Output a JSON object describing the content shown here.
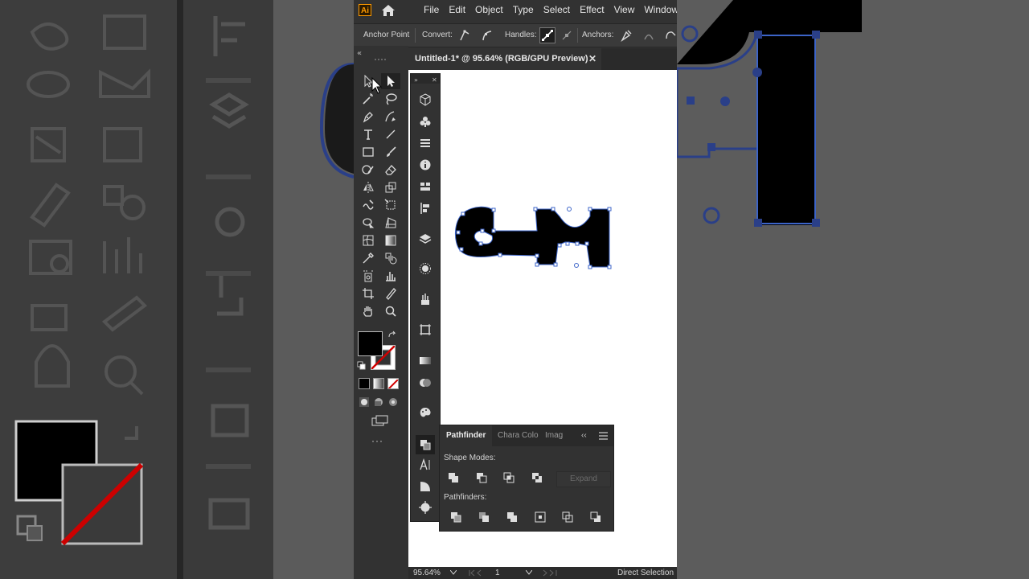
{
  "app": {
    "logo": "Ai"
  },
  "menu": [
    "File",
    "Edit",
    "Object",
    "Type",
    "Select",
    "Effect",
    "View",
    "Window"
  ],
  "control_bar": {
    "title": "Anchor Point",
    "convert": "Convert:",
    "handles": "Handles:",
    "anchors": "Anchors:"
  },
  "document_tab": {
    "title": "Untitled-1* @ 95.64% (RGB/GPU Preview)",
    "close": "✕"
  },
  "pathfinder": {
    "tabs": [
      "Pathfinder",
      "Chara",
      "Colo",
      "Imag"
    ],
    "collapse": "‹‹",
    "shape_modes_label": "Shape Modes:",
    "pathfinders_label": "Pathfinders:",
    "expand_label": "Expand"
  },
  "toolbar": {
    "more": "···"
  },
  "status": {
    "zoom": "95.64%",
    "artboard": "1",
    "tool": "Direct Selection"
  },
  "colors": {
    "accent": "#ff9a00",
    "path_selection": "#3c64c8",
    "fill": "#000000",
    "stroke_none": "#d00000"
  }
}
